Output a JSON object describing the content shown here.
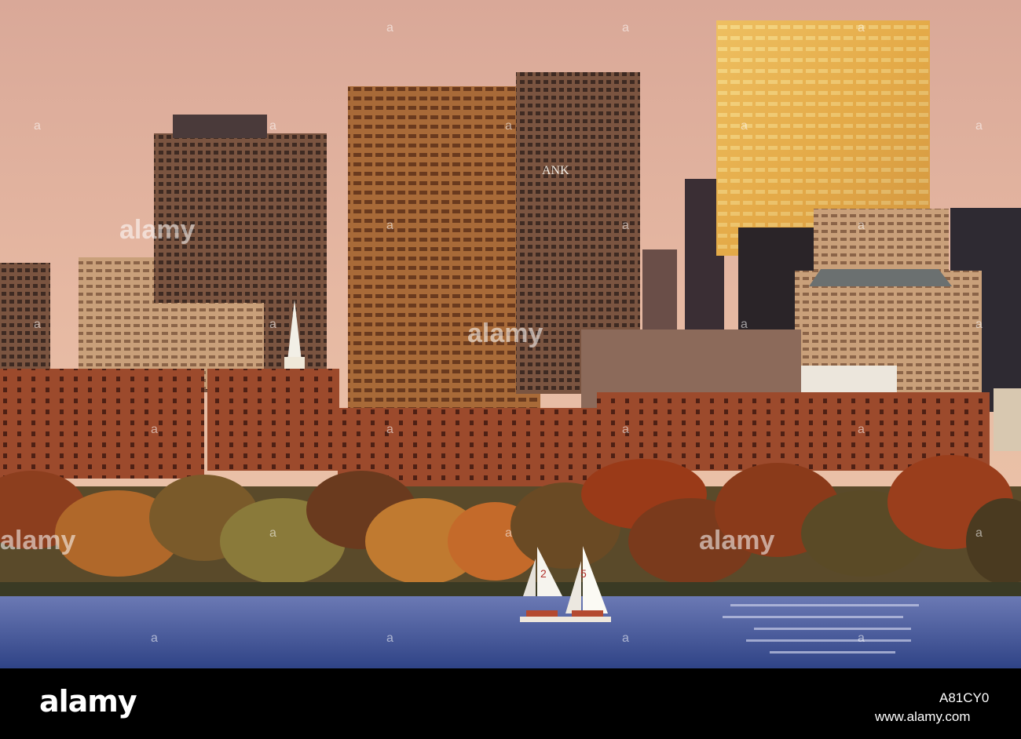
{
  "photo": {
    "subject": "city skyline across a river at sunset with sailboats",
    "sail_numbers": [
      "2",
      "5"
    ],
    "building_sign": "ANK",
    "watermark_text": "alamy",
    "watermark_mark": "a",
    "colors": {
      "sky": "#e7b6a0",
      "water": "#4a5f9e",
      "foliage": "#a4572a",
      "golden_tower": "#e8b24a"
    }
  },
  "footer": {
    "logo": "alamy",
    "image_id": "A81CY0",
    "site": "www.alamy.com"
  }
}
